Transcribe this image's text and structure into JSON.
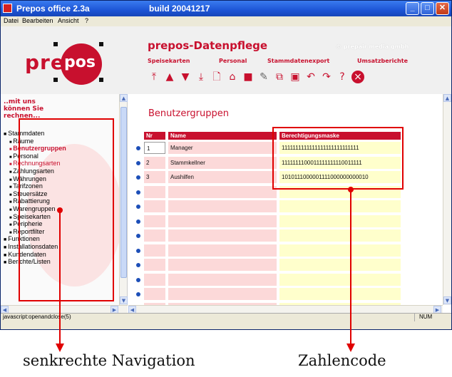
{
  "window": {
    "title": "Prepos office 2.3a",
    "build": "build 20041217"
  },
  "menu": [
    "Datei",
    "Bearbeiten",
    "Ansicht",
    "?"
  ],
  "logo": {
    "pre": "pre",
    "pos": "pos"
  },
  "app": {
    "title": "prepos-Datenpflege",
    "copyright": "© prepair media gmbh",
    "nav_links": [
      "Speisekarten",
      "Personal",
      "Stammdatenexport",
      "Umsatzberichte"
    ]
  },
  "toolbar_icons": [
    "first-icon",
    "up-icon",
    "down-icon",
    "last-icon",
    "new-page-icon",
    "home-icon",
    "save-icon",
    "edit-icon",
    "copy-icon",
    "paste-icon",
    "undo-icon",
    "redo-icon",
    "help-icon",
    "close-circle-icon"
  ],
  "sidebar": {
    "tagline": "..mit uns können Sie rechnen...",
    "items": [
      {
        "label": "Stammdaten",
        "level": 0
      },
      {
        "label": "Räume",
        "level": 1
      },
      {
        "label": "Benutzergruppen",
        "level": 1,
        "active": true
      },
      {
        "label": "Personal",
        "level": 1
      },
      {
        "label": "Rechnungsarten",
        "level": 1,
        "red": true
      },
      {
        "label": "Zahlungsarten",
        "level": 1
      },
      {
        "label": "Währungen",
        "level": 1
      },
      {
        "label": "Tarifzonen",
        "level": 1
      },
      {
        "label": "Steuersätze",
        "level": 1
      },
      {
        "label": "Rabattierung",
        "level": 1
      },
      {
        "label": "Warengruppen",
        "level": 1
      },
      {
        "label": "Speisekarten",
        "level": 1
      },
      {
        "label": "Peripherie",
        "level": 1
      },
      {
        "label": "Reportfilter",
        "level": 1
      },
      {
        "label": "Funktionen",
        "level": 0
      },
      {
        "label": "Installationsdaten",
        "level": 0
      },
      {
        "label": "Kundendaten",
        "level": 0
      },
      {
        "label": "Berichte/Listen",
        "level": 0
      }
    ]
  },
  "main": {
    "page_title": "Benutzergruppen",
    "columns": [
      "Nr",
      "Name",
      "Berechtigungsmaske"
    ],
    "rows": [
      {
        "nr": "1",
        "name": "Manager",
        "mask": "1111111111111111111111111111"
      },
      {
        "nr": "2",
        "name": "Stammkellner",
        "mask": "1111111100011111111110011111"
      },
      {
        "nr": "3",
        "name": "Aushilfen",
        "mask": "1010111000001111000000000010"
      }
    ],
    "empty_rows": 10
  },
  "status": {
    "text": "javascript:openandclose(5)",
    "num": "NUM"
  },
  "annotations": {
    "left_caption": "senkrechte Navigation",
    "right_caption": "Zahlencode",
    "color": "#e00000"
  },
  "colors": {
    "accent": "#c8102e",
    "pink_cell": "#fcd9d9",
    "yellow_cell": "#ffffcc"
  }
}
